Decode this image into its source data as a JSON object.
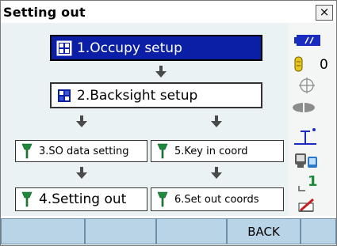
{
  "window": {
    "title": "Setting out",
    "close_label": "×"
  },
  "menu": {
    "occupy": "1.Occupy setup",
    "backsight": "2.Backsight setup",
    "so_data": "3.SO data setting",
    "setting_out": "4.Setting out",
    "key_in": "5.Key in coord",
    "set_out_coords": "6.Set out coords"
  },
  "status": {
    "memory_count": "0",
    "channel": "1"
  },
  "softkeys": [
    "",
    "",
    "",
    "BACK",
    ""
  ],
  "colors": {
    "selected_bg": "#0b1ea6",
    "content_bg": "#eaf2f4",
    "softkey_bg": "#b9d4e7",
    "arrow": "#4a4a4a"
  }
}
